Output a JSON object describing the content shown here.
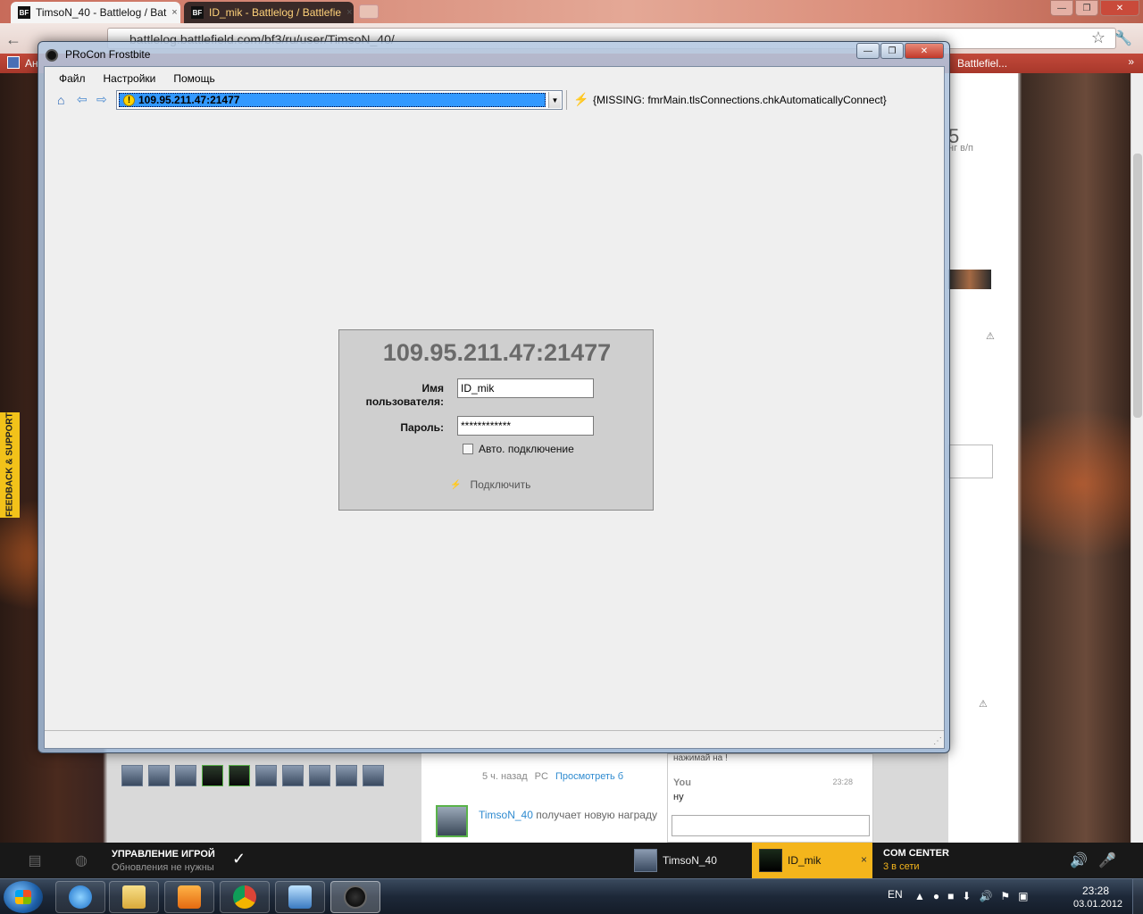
{
  "browser": {
    "tabs": [
      {
        "badge": "BF",
        "title": "TimsoN_40 - Battlelog / Bat"
      },
      {
        "badge": "BF",
        "title": "ID_mik - Battlelog / Battlefie"
      }
    ],
    "tab_close": "×",
    "window_controls": {
      "minimize": "—",
      "maximize": "❐",
      "close": "✕"
    },
    "back_glyph": "←",
    "url": "battlelog.battlefield.com/bf3/ru/user/TimsoN_40/",
    "star_glyph": "☆",
    "wrench_glyph": "🔧",
    "bookmarks": {
      "left_text": "Ан",
      "right_text": "Battlefiel...",
      "more": "»"
    }
  },
  "background_page": {
    "feedback_label": "FEEDBACK & SUPPORT",
    "kd_fragment": "5",
    "kd_label": "нг в/п",
    "warn_glyph": "⚠",
    "feed": {
      "time": "5 ч. назад",
      "platform": "PC",
      "link": "Просмотреть б",
      "author": "TimsoN_40",
      "text": "получает новую награду"
    },
    "chat": {
      "previous_text": "нажимай на !",
      "sender": "You",
      "time": "23:28",
      "message": "ну"
    }
  },
  "com_bar": {
    "game_mgmt_title": "УПРАВЛЕНИЕ ИГРОЙ",
    "game_mgmt_sub": "Обновления не нужны",
    "check_glyph": "✓",
    "friends": [
      {
        "name": "TimsoN_40"
      },
      {
        "name": "ID_mik"
      }
    ],
    "friend_close": "×",
    "com_center_title": "COM CENTER",
    "com_center_sub": "3 в сети",
    "volume_glyph": "🔊",
    "mic_glyph": "🎤"
  },
  "taskbar": {
    "lang": "EN",
    "tray_glyphs": [
      "▲",
      "●",
      "■",
      "⬇",
      "🔊",
      "⚑",
      "▣"
    ],
    "time": "23:28",
    "date": "03.01.2012"
  },
  "procon": {
    "title": "PRoCon Frostbite",
    "controls": {
      "minimize": "—",
      "maximize": "❐",
      "close": "✕"
    },
    "menu": [
      "Файл",
      "Настройки",
      "Помощь"
    ],
    "toolbar": {
      "home_glyph": "⌂",
      "back_glyph": "⇦",
      "forward_glyph": "⇨",
      "warning_glyph": "!",
      "server_value": "109.95.211.47:21477",
      "combo_arrow": "▼",
      "plug_glyph": "⚡",
      "auto_connect_text": "{MISSING: fmrMain.tlsConnections.chkAutomaticallyConnect}"
    },
    "login": {
      "host": "109.95.211.47:21477",
      "username_label": "Имя пользователя:",
      "username_value": "ID_mik",
      "password_label": "Пароль:",
      "password_value": "************",
      "auto_connect_label": "Авто. подключение",
      "auto_connect_checked": false,
      "connect_label": "Подключить",
      "connect_glyph": "⚡"
    },
    "resize_glyph": "⋰"
  },
  "colors": {
    "selection": "#3399ff",
    "friend_active": "#f4b51c",
    "link": "#2f8bd0"
  }
}
